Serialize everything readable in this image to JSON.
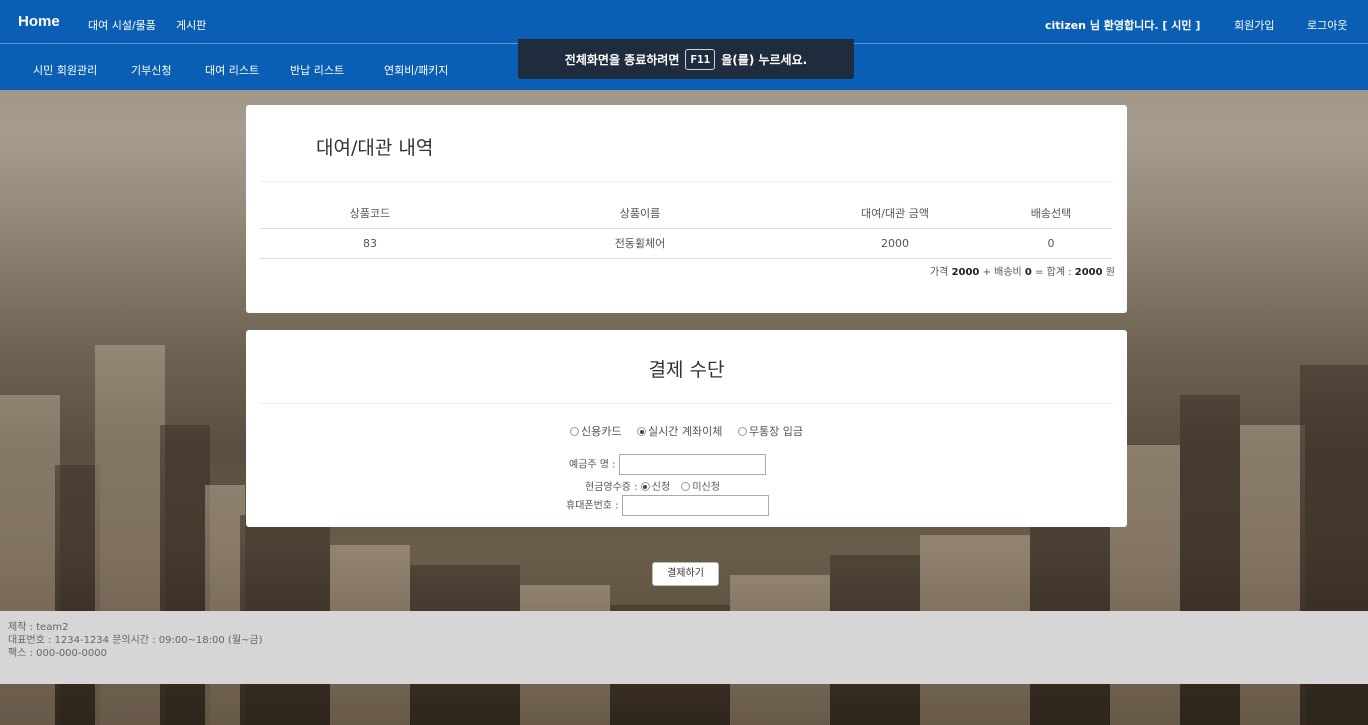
{
  "nav": {
    "home": "Home",
    "rental_facilities": "대여 시설/물품",
    "board": "게시판",
    "welcome_user": "citizen",
    "welcome_text": " 님 환영합니다. [ 시민 ]",
    "signup": "회원가입",
    "logout": "로그아웃",
    "sub_items": [
      "시민 회원관리",
      "기부신청",
      "대여 리스트",
      "반납 리스트",
      "연회비/패키지"
    ]
  },
  "fullscreen_toast": {
    "before": "전체화면을 종료하려면",
    "key": "F11",
    "after": "을(를) 누르세요."
  },
  "rental_history": {
    "title": "대여/대관 내역",
    "columns": [
      "상품코드",
      "상품이름",
      "대여/대관 금액",
      "배송선택"
    ],
    "rows": [
      [
        "83",
        "전동휠체어",
        "2000",
        "0"
      ]
    ],
    "summary": {
      "price_label": "가격 ",
      "price": "2000",
      "shipping_label": " + 배송비 ",
      "shipping": "0",
      "total_label": " = 합계 : ",
      "total": "2000",
      "unit": " 원"
    }
  },
  "payment": {
    "title": "결제 수단",
    "methods": [
      "신용카드",
      "실시간 계좌이체",
      "무통장 입금"
    ],
    "selected_method": "실시간 계좌이체",
    "depositor_label": "예금주 명 :",
    "depositor_value": "",
    "receipt_label": "현금영수증 :",
    "receipt_options": [
      "신청",
      "미신청"
    ],
    "receipt_selected": "신청",
    "phone_label": "휴대폰번호 :",
    "phone_value": "",
    "submit": "결제하기"
  },
  "footer": {
    "line1": "제작 : team2",
    "line2": "대표번호 : 1234-1234 문의시간 : 09:00~18:00 (월~금)",
    "line3": "팩스 : 000-000-0000"
  }
}
